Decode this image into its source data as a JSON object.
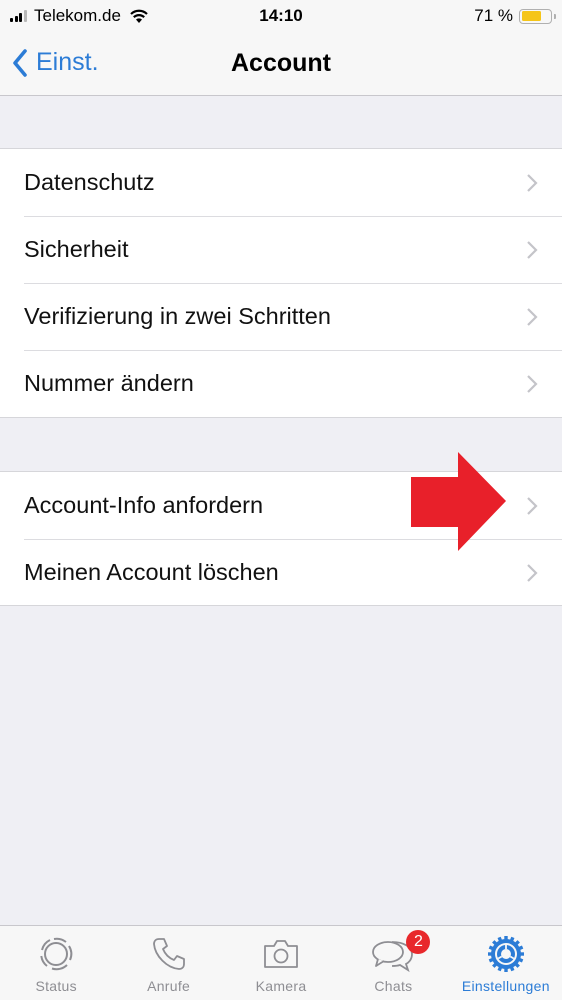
{
  "status_bar": {
    "carrier": "Telekom.de",
    "time": "14:10",
    "battery_percent_text": "71 %",
    "battery_level": 0.71,
    "signal_bars_active": 3,
    "signal_bars_total": 4
  },
  "nav": {
    "back_label": "Einst.",
    "title": "Account"
  },
  "groups": [
    {
      "items": [
        {
          "label": "Datenschutz"
        },
        {
          "label": "Sicherheit"
        },
        {
          "label": "Verifizierung in zwei Schritten"
        },
        {
          "label": "Nummer ändern"
        }
      ]
    },
    {
      "items": [
        {
          "label": "Account-Info anfordern"
        },
        {
          "label": "Meinen Account löschen"
        }
      ]
    }
  ],
  "annotation": {
    "type": "red-arrow",
    "points_to": "Account-Info anfordern",
    "color": "#e8202a"
  },
  "tab_bar": {
    "tabs": [
      {
        "label": "Status",
        "icon": "status-icon",
        "active": false
      },
      {
        "label": "Anrufe",
        "icon": "phone-icon",
        "active": false
      },
      {
        "label": "Kamera",
        "icon": "camera-icon",
        "active": false
      },
      {
        "label": "Chats",
        "icon": "chats-icon",
        "active": false,
        "badge": "2"
      },
      {
        "label": "Einstellungen",
        "icon": "settings-gear-icon",
        "active": true
      }
    ]
  },
  "colors": {
    "accent": "#2c7cd6",
    "badge": "#e8282b",
    "battery": "#f5c518",
    "background": "#efeff4"
  }
}
